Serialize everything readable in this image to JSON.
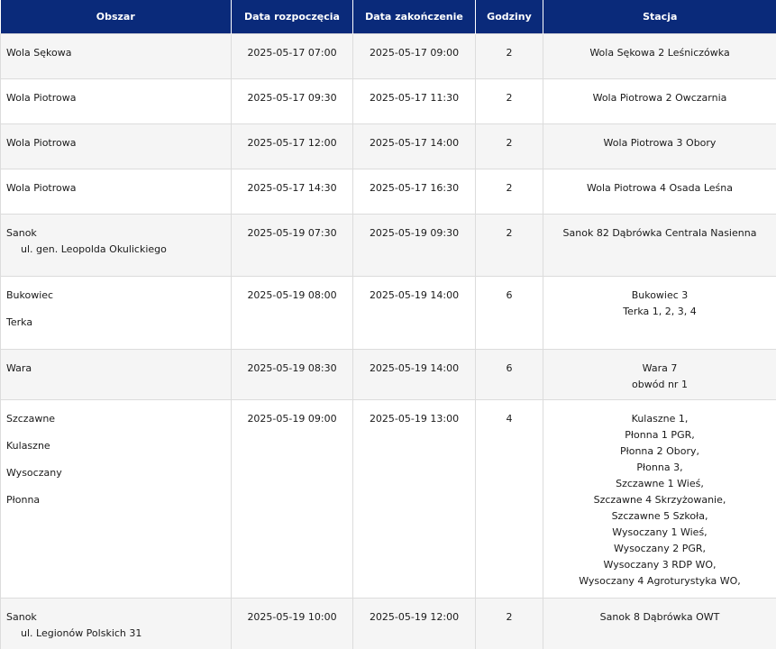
{
  "headers": {
    "area": "Obszar",
    "start": "Data rozpoczęcia",
    "end": "Data zakończenie",
    "hours": "Godziny",
    "station": "Stacja"
  },
  "rows": [
    {
      "areas": [
        "Wola Sękowa"
      ],
      "sub": "",
      "start": "2025-05-17 07:00",
      "end": "2025-05-17 09:00",
      "hours": "2",
      "stations": [
        "Wola Sękowa 2 Leśniczówka"
      ]
    },
    {
      "areas": [
        "Wola Piotrowa"
      ],
      "sub": "",
      "start": "2025-05-17 09:30",
      "end": "2025-05-17 11:30",
      "hours": "2",
      "stations": [
        "Wola Piotrowa 2 Owczarnia"
      ]
    },
    {
      "areas": [
        "Wola Piotrowa"
      ],
      "sub": "",
      "start": "2025-05-17 12:00",
      "end": "2025-05-17 14:00",
      "hours": "2",
      "stations": [
        "Wola Piotrowa 3 Obory"
      ]
    },
    {
      "areas": [
        "Wola Piotrowa"
      ],
      "sub": "",
      "start": "2025-05-17 14:30",
      "end": "2025-05-17 16:30",
      "hours": "2",
      "stations": [
        "Wola Piotrowa 4 Osada Leśna"
      ]
    },
    {
      "areas": [
        "Sanok"
      ],
      "sub": "ul. gen. Leopolda Okulickiego",
      "start": "2025-05-19 07:30",
      "end": "2025-05-19 09:30",
      "hours": "2",
      "stations": [
        "Sanok 82 Dąbrówka Centrala Nasienna"
      ]
    },
    {
      "areas": [
        "Bukowiec",
        "Terka"
      ],
      "sub": "",
      "start": "2025-05-19 08:00",
      "end": "2025-05-19 14:00",
      "hours": "6",
      "stations": [
        "Bukowiec 3",
        "Terka 1, 2, 3, 4"
      ]
    },
    {
      "areas": [
        "Wara"
      ],
      "sub": "",
      "start": "2025-05-19 08:30",
      "end": "2025-05-19 14:00",
      "hours": "6",
      "stations": [
        "Wara 7",
        "obwód nr 1"
      ]
    },
    {
      "areas": [
        "Szczawne",
        "Kulaszne",
        "Wysoczany",
        "Płonna"
      ],
      "sub": "",
      "start": "2025-05-19 09:00",
      "end": "2025-05-19 13:00",
      "hours": "4",
      "stations": [
        "Kulaszne 1,",
        "Płonna 1 PGR,",
        "Płonna 2 Obory,",
        "Płonna 3,",
        "Szczawne 1 Wieś,",
        "Szczawne 4 Skrzyżowanie,",
        "Szczawne 5 Szkoła,",
        "Wysoczany 1 Wieś,",
        "Wysoczany 2 PGR,",
        "Wysoczany 3 RDP WO,",
        "Wysoczany 4 Agroturystyka WO,"
      ]
    },
    {
      "areas": [
        "Sanok"
      ],
      "sub": "ul. Legionów Polskich 31",
      "start": "2025-05-19 10:00",
      "end": "2025-05-19 12:00",
      "hours": "2",
      "stations": [
        "Sanok 8 Dąbrówka OWT"
      ]
    }
  ]
}
